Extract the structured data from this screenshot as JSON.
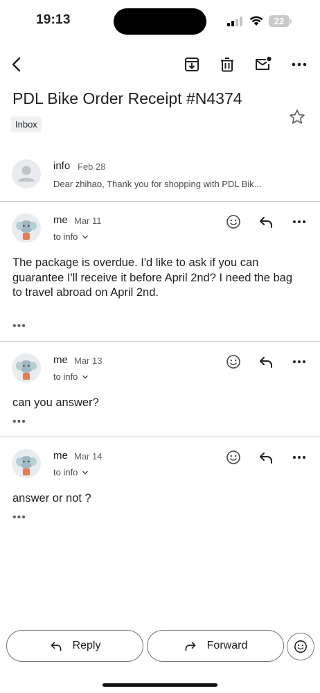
{
  "status_bar": {
    "time": "19:13",
    "battery": "22"
  },
  "toolbar": {
    "back_icon": "back-arrow-icon",
    "archive_icon": "archive-icon",
    "delete_icon": "trash-icon",
    "mark_unread_icon": "mark-unread-icon",
    "more_icon": "more-horiz-icon"
  },
  "thread": {
    "subject": "PDL Bike Order Receipt #N4374",
    "label": "Inbox"
  },
  "messages": [
    {
      "sender": "info",
      "date": "Feb 28",
      "snippet": "Dear zhihao, Thank you for shopping with PDL Bik...",
      "collapsed": true
    },
    {
      "sender": "me",
      "date": "Mar 11",
      "to": "to info",
      "body": "The package is overdue. I'd like to ask if you can guarantee I'll receive it before April 2nd? I need the bag to travel abroad on April 2nd.",
      "more": "•••"
    },
    {
      "sender": "me",
      "date": "Mar 13",
      "to": "to info",
      "body": "can you answer?",
      "more": "•••"
    },
    {
      "sender": "me",
      "date": "Mar 14",
      "to": "to info",
      "body": "answer or not ?",
      "more": "•••"
    }
  ],
  "actions": {
    "reply": "Reply",
    "forward": "Forward"
  },
  "colors": {
    "text": "#1f1f1f",
    "secondary": "#5f6368",
    "divider": "#c6c6c6",
    "chip": "#eef0f2"
  }
}
